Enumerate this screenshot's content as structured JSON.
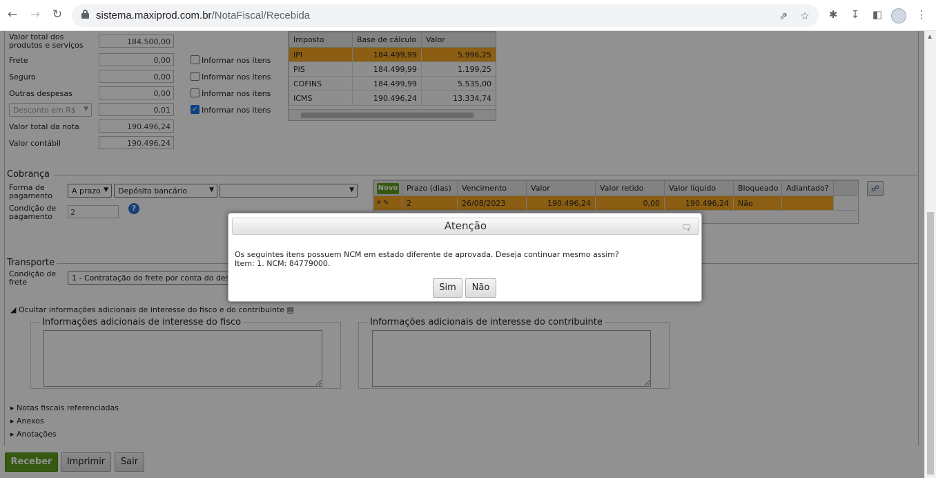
{
  "browser": {
    "url_host": "sistema.maxiprod.com.br",
    "url_path": "/NotaFiscal/Recebida"
  },
  "totals": {
    "valor_total_label": "Valor total dos produtos e serviços",
    "valor_total": "184.500,00",
    "frete_label": "Frete",
    "frete": "0,00",
    "seguro_label": "Seguro",
    "seguro": "0,00",
    "outras_label": "Outras despesas",
    "outras": "0,00",
    "desconto_select": "Desconto em R$",
    "desconto": "0,01",
    "total_nota_label": "Valor total da nota",
    "total_nota": "190.496,24",
    "contabil_label": "Valor contábil",
    "contabil": "190.496,24",
    "informar_label": "Informar nos itens"
  },
  "impostos": {
    "headers": [
      "Imposto",
      "Base de cálculo",
      "Valor"
    ],
    "rows": [
      {
        "imposto": "IPI",
        "base": "184.499,99",
        "valor": "5.996,25"
      },
      {
        "imposto": "PIS",
        "base": "184.499,99",
        "valor": "1.199,25"
      },
      {
        "imposto": "COFINS",
        "base": "184.499,99",
        "valor": "5.535,00"
      },
      {
        "imposto": "ICMS",
        "base": "190.496,24",
        "valor": "13.334,74"
      }
    ]
  },
  "cobranca": {
    "title": "Cobrança",
    "forma_label": "Forma de pagamento",
    "forma_value": "A prazo",
    "tipo_value": "Depósito bancário",
    "extra_value": "",
    "condicao_label": "Condição de pagamento",
    "condicao_value": "2",
    "novo_label": "Novo",
    "headers": [
      "Prazo (dias)",
      "Vencimento",
      "Valor",
      "Valor retido",
      "Valor líquido",
      "Bloqueado",
      "Adiantado?"
    ],
    "row": {
      "prazo": "2",
      "vencimento": "26/08/2023",
      "valor": "190.496,24",
      "retido": "0,00",
      "liquido": "190.496,24",
      "bloqueado": "Não",
      "adiantado": ""
    }
  },
  "transporte": {
    "title": "Transporte",
    "condicao_label": "Condição de frete",
    "condicao_value": "1 - Contratação do frete por conta do dest"
  },
  "adicionais": {
    "toggle_label": "Ocultar informações adicionais de interesse do fisco e do contribuinte",
    "fisco_title": "Informações adicionais de interesse do fisco",
    "contrib_title": "Informações adicionais de interesse do contribuinte"
  },
  "links": {
    "notas": "Notas fiscais referenciadas",
    "anexos": "Anexos",
    "anotacoes": "Anotações"
  },
  "actions": {
    "receber": "Receber",
    "imprimir": "Imprimir",
    "sair": "Sair"
  },
  "dialog": {
    "title": "Atenção",
    "line1": "Os seguintes itens possuem NCM em estado diferente de aprovada. Deseja continuar mesmo assim?",
    "line2": "Item: 1. NCM: 84779000.",
    "yes": "Sim",
    "no": "Não"
  }
}
